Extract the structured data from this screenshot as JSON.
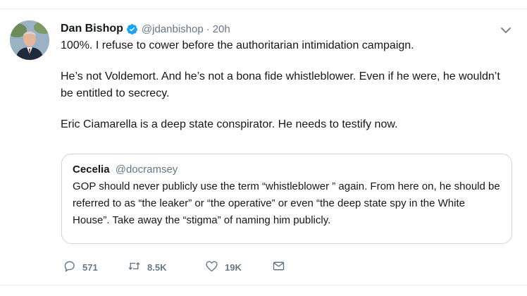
{
  "tweet": {
    "author": {
      "name": "Dan Bishop",
      "handle": "@jdanbishop",
      "time": "20h",
      "separator": "·"
    },
    "paragraphs": [
      "100%.  I refuse to cower before the authoritarian intimidation campaign.",
      "He’s not Voldemort.  And he’s not a bona fide whistleblower.  Even if he were, he wouldn’t be entitled to secrecy.",
      "Eric Ciamarella is a deep state conspirator. He needs to testify now."
    ],
    "quoted": {
      "name": "Cecelia",
      "handle": "@docramsey",
      "text": "GOP should never publicly use the term “whistleblower ” again. From here on, he should be referred to as “the leaker” or “the operative” or even “the deep state spy in the White House”. Take away the “stigma” of naming him publicly."
    },
    "actions": {
      "replies": "571",
      "retweets": "8.5K",
      "likes": "19K"
    }
  },
  "colors": {
    "verified": "#1da1f2",
    "secondary_text": "#657786",
    "border": "#ccd6dd"
  },
  "icons": [
    "verified-badge-icon",
    "chevron-down-icon",
    "reply-icon",
    "retweet-icon",
    "like-icon",
    "direct-message-icon"
  ]
}
